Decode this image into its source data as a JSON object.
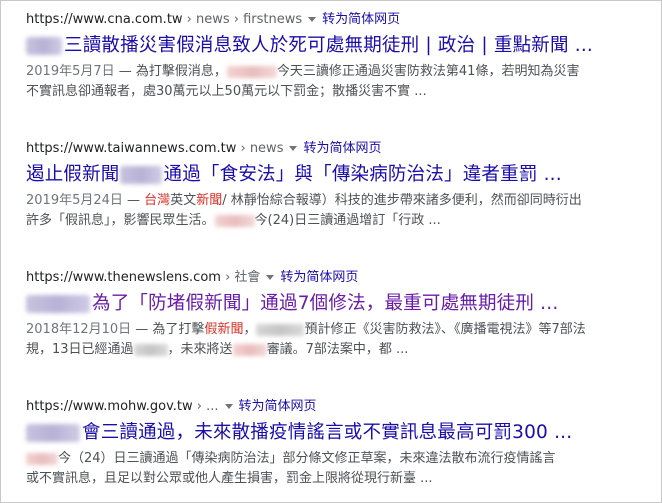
{
  "results": [
    {
      "url": "https://www.cna.com.tw",
      "crumbs": " › news › firstnews",
      "translate": "转为简体网页",
      "title": "三讀散播災害假消息致人於死可處無期徒刑 | 政治 | 重點新聞 ...",
      "date": "2019年5月7日",
      "snip1a": " — 為打擊假消息，",
      "snip1b": "今天三讀修正通過災害防救法第41條，若明知為災害",
      "snip2": "不實訊息卻通報者，處30萬元以上50萬元以下罰金；散播災害不實 ..."
    },
    {
      "url": "https://www.taiwannews.com.tw",
      "crumbs": " › news",
      "translate": "转为简体网页",
      "title_a": "遏止假新聞",
      "title_b": "通過「食安法」與「傳染病防治法」違者重罰 ...",
      "date": "2019年5月24日",
      "snip1_dash": " — ",
      "snip1_red1": "台灣",
      "snip1_mid": "英文",
      "snip1_red2": "新聞",
      "snip1_rest": "/ 林靜怡綜合報導）",
      "snip1_tail": "科技的進步帶來諸多便利，然而卻同時衍出",
      "snip2a": "許多「假訊息」，影響民眾生活。",
      "snip2b": "今(24)日三讀通過增訂「行政 ..."
    },
    {
      "url": "https://www.thenewslens.com",
      "crumbs": " › 社會",
      "translate": "转为简体网页",
      "title": "為了「防堵假新聞」通過7個修法，最重可處無期徒刑 ...",
      "date": "2018年12月10日",
      "snip1a": " — 為了打擊",
      "snip1_red": "假新聞",
      "snip1b": "，",
      "snip1c": "預計修正《災害防救法》、《廣播電視法》等7部法",
      "snip2a": "規，13日已經通過",
      "snip2b": "，未來將送",
      "snip2c": "審議。7部法案中，都 ..."
    },
    {
      "url": "https://www.mohw.gov.tw",
      "crumbs": " › ...",
      "translate": "转为简体网页",
      "title": "會三讀通過，未來散播疫情謠言或不實訊息最高可罰300 ...",
      "snip1": "今（24）日三讀通過「傳染病防治法」部分條文修正草案，未來違法散布流行疫情謠言",
      "snip2": "或不實訊息，且足以對公眾或他人產生損害，罰金上限將從現行新臺 ..."
    }
  ]
}
